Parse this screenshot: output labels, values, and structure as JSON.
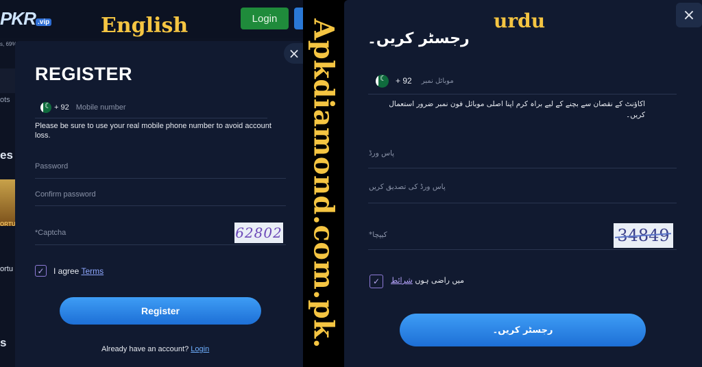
{
  "overlay": {
    "left_label": "English",
    "right_label": "urdu",
    "watermark": "Apkdiamond.com.pk."
  },
  "background": {
    "logo_text": "PKR",
    "logo_badge": ".vip",
    "login_button": "Login",
    "fragments": [
      "s, 69%",
      "ots",
      "es",
      "ORTU",
      "ortu",
      "s"
    ]
  },
  "english": {
    "title": "REGISTER",
    "close_icon": "×",
    "phone_code": "+ 92",
    "phone_placeholder": "Mobile number",
    "note": "Please be sure to use your real mobile phone number to avoid account loss.",
    "password_placeholder": "Password",
    "confirm_placeholder": "Confirm password",
    "captcha_label": "*Captcha",
    "captcha_code": "62802",
    "agree_text": "I agree",
    "terms_link": "Terms",
    "register_button": "Register",
    "already_text": "Already have an account?",
    "login_link": "Login"
  },
  "urdu": {
    "title": "رجسٹر کریں۔",
    "close_icon": "×",
    "phone_code": "+ 92",
    "phone_placeholder": "موبائل نمبر",
    "note": "اکاؤنٹ کے نقصان سے بچنے کے لیے براہ کرم اپنا اصلی موبائل فون نمبر ضرور استعمال کریں۔",
    "password_placeholder": "پاس ورڈ",
    "confirm_placeholder": "پاس ورڈ کی تصدیق کریں",
    "captcha_label": "کیپچا*",
    "captcha_code": "34849",
    "agree_text": "میں راضی ہوں",
    "terms_link": "شرائط",
    "register_button": "رجسٹر کریں۔"
  },
  "colors": {
    "accent_gold": "#f5c542",
    "button_blue": "#2a86e8",
    "modal_bg": "#111a30",
    "login_green": "#1f8b3b"
  }
}
